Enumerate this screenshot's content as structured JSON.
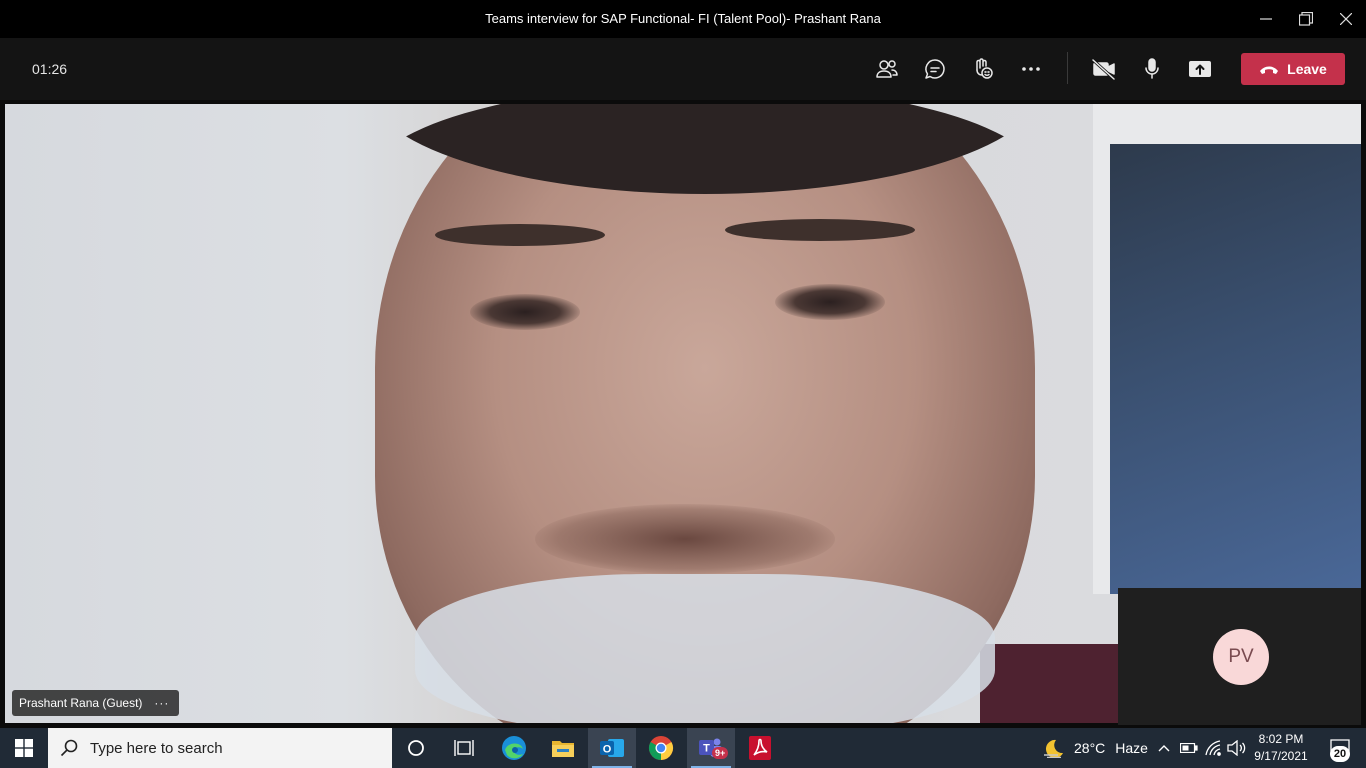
{
  "window": {
    "title": "Teams interview for SAP Functional- FI (Talent Pool)- Prashant Rana",
    "controls": [
      "minimize-icon",
      "restore-icon",
      "close-icon"
    ]
  },
  "toolbar": {
    "timer": "01:26",
    "icons": [
      "participants-icon",
      "chat-icon",
      "reactions-icon",
      "more-icon",
      "camera-off-icon",
      "microphone-icon",
      "share-icon"
    ],
    "leave_label": "Leave",
    "leave_color": "#c4314b"
  },
  "stage": {
    "participant_name": "Prashant Rana (Guest)",
    "participant_more": "···",
    "self_initials": "PV"
  },
  "taskbar": {
    "search_placeholder": "Type here to search",
    "apps": [
      "windows-start-icon",
      "cortana-icon",
      "task-view-icon",
      "edge-icon",
      "file-explorer-icon",
      "outlook-icon",
      "chrome-icon",
      "teams-icon",
      "acrobat-icon"
    ],
    "teams_badge": "9+",
    "weather": {
      "temp": "28°C",
      "condition": "Haze"
    },
    "time": "8:02 PM",
    "date": "9/17/2021",
    "notifications": "20"
  }
}
